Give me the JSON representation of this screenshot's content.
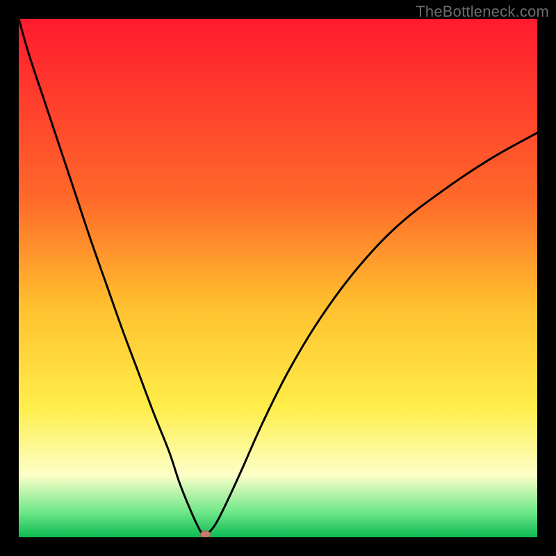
{
  "watermark": "TheBottleneck.com",
  "colors": {
    "frame": "#000000",
    "curve": "#000000",
    "marker_fill": "#c77b6e",
    "marker_stroke": "#a85f52",
    "gradient_top": "#ff1a2e",
    "gradient_mid_orange": "#ffa83a",
    "gradient_yellow": "#ffe93a",
    "gradient_pale": "#fbffd2",
    "gradient_green": "#18e06a",
    "gradient_green_deep": "#0dbb53"
  },
  "chart_data": {
    "type": "line",
    "title": "",
    "xlabel": "",
    "ylabel": "",
    "xlim": [
      0,
      100
    ],
    "ylim": [
      0,
      100
    ],
    "grid": false,
    "legend": null,
    "notes": "V-shaped bottleneck curve. Vertical gradient encodes bottleneck severity (green≈0%, red≈100%). Single marker at curve minimum.",
    "series": [
      {
        "name": "bottleneck_curve",
        "x": [
          0,
          2,
          5,
          8,
          11,
          14,
          17,
          20,
          23,
          26,
          29,
          31,
          33,
          34.5,
          35.5,
          36.5,
          38,
          40,
          43,
          47,
          52,
          58,
          65,
          73,
          82,
          91,
          100
        ],
        "y": [
          100,
          93,
          84,
          75,
          66,
          57,
          48.5,
          40,
          32,
          24,
          16.5,
          10.5,
          5.5,
          2.2,
          0.6,
          0.8,
          2.6,
          6.5,
          13,
          22,
          32,
          42,
          51.5,
          60,
          67,
          73,
          78
        ]
      }
    ],
    "marker": {
      "x": 36,
      "y": 0.5
    },
    "gradient_stops": [
      {
        "pct": 0,
        "value": 100,
        "color": "#ff1a2e"
      },
      {
        "pct": 35,
        "value": 65,
        "color": "#ff6a2a"
      },
      {
        "pct": 55,
        "value": 45,
        "color": "#ffbf2e"
      },
      {
        "pct": 75,
        "value": 25,
        "color": "#ffee4a"
      },
      {
        "pct": 88,
        "value": 12,
        "color": "#fdffc8"
      },
      {
        "pct": 95,
        "value": 5,
        "color": "#72e88a"
      },
      {
        "pct": 100,
        "value": 0,
        "color": "#0dbb53"
      }
    ]
  }
}
